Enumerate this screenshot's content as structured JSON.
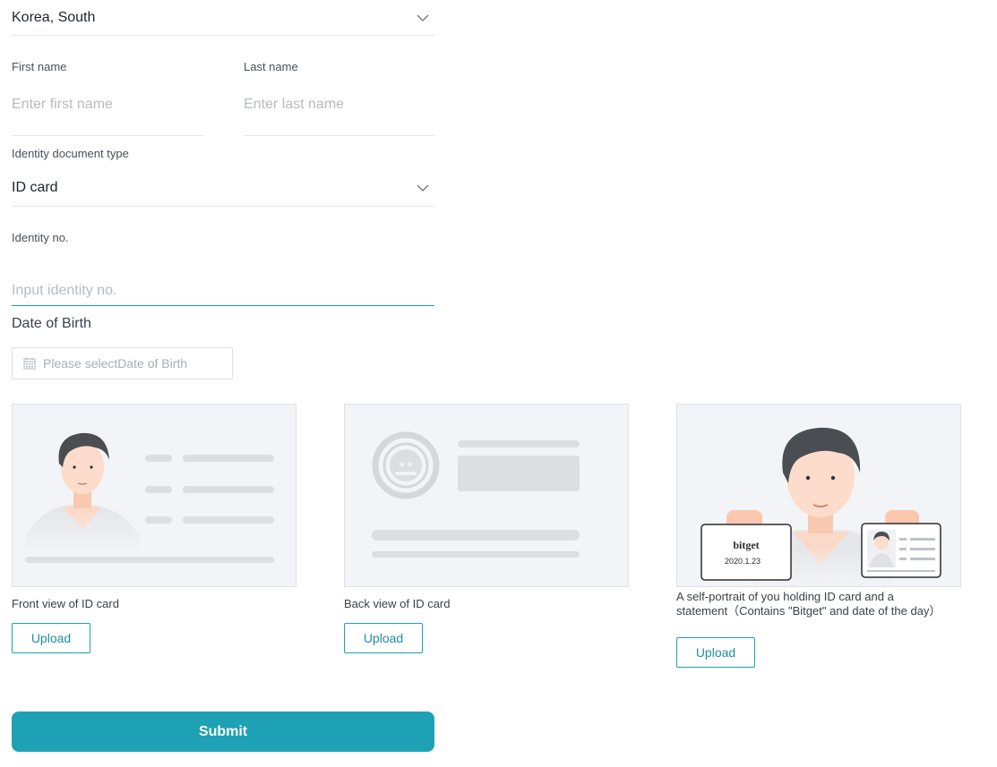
{
  "country": {
    "value": "Korea, South"
  },
  "first_name": {
    "label": "First name",
    "placeholder": "Enter first name"
  },
  "last_name": {
    "label": "Last name",
    "placeholder": "Enter last name"
  },
  "document_type": {
    "label": "Identity document type",
    "value": "ID card"
  },
  "identity_no": {
    "label": "Identity no.",
    "placeholder": "Input identity no."
  },
  "dob": {
    "label": "Date of Birth",
    "placeholder": "Please selectDate of Birth",
    "icon": "calendar-icon"
  },
  "uploads": [
    {
      "caption": "Front view of ID card",
      "button": "Upload"
    },
    {
      "caption": "Back view of ID card",
      "button": "Upload"
    },
    {
      "caption": "A self-portrait of you holding ID card and a statement（Contains \"Bitget\" and date of the day）",
      "button": "Upload"
    }
  ],
  "selfie_card": {
    "brand": "bitget",
    "date": "2020.1.23"
  },
  "submit_label": "Submit",
  "colors": {
    "accent": "#1ea1b4",
    "card_bg": "#f2f4f7",
    "placeholder": "#b6bbc2"
  }
}
